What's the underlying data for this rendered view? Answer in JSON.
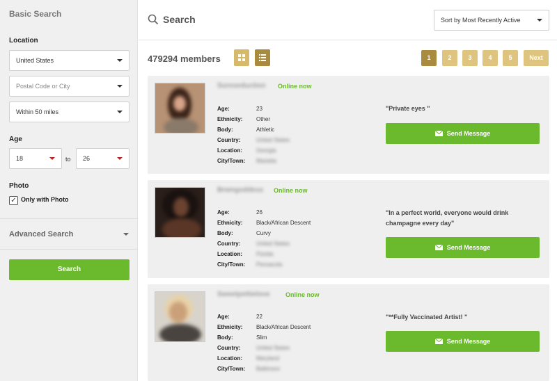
{
  "sidebar": {
    "title": "Basic Search",
    "location_label": "Location",
    "country": "United States",
    "postal_placeholder": "Postal Code or City",
    "distance": "Within 50 miles",
    "age_label": "Age",
    "age_min": "18",
    "age_to": "to",
    "age_max": "26",
    "photo_label": "Photo",
    "photo_checkbox_label": "Only with Photo",
    "photo_checked": "✓",
    "advanced_label": "Advanced Search",
    "search_button": "Search"
  },
  "header": {
    "title": "Search",
    "sort_value": "Sort by Most Recently Active"
  },
  "toolbar": {
    "members_count": "479294 members",
    "pages": [
      "1",
      "2",
      "3",
      "4",
      "5"
    ],
    "active_page": "1",
    "next_label": "Next"
  },
  "detail_labels": {
    "age": "Age:",
    "ethnicity": "Ethnicity:",
    "body": "Body:",
    "country": "Country:",
    "location": "Location:",
    "city": "City/Town:"
  },
  "profiles": [
    {
      "username": "Sureseduction",
      "status": "Online now",
      "age": "23",
      "ethnicity": "Other",
      "body": "Athletic",
      "country": "United States",
      "location": "Georgia",
      "city": "Marietta",
      "quote": "\"Private eyes \"",
      "message_button": "Send Message"
    },
    {
      "username": "Brwngoddess",
      "status": "Online now",
      "age": "26",
      "ethnicity": "Black/African Descent",
      "body": "Curvy",
      "country": "United States",
      "location": "Florida",
      "city": "Pensacola",
      "quote": "\"In a perfect world, everyone would drink champagne every day\"",
      "message_button": "Send Message"
    },
    {
      "username": "Sweetpettielove",
      "status": "Online now",
      "age": "22",
      "ethnicity": "Black/African Descent",
      "body": "Slim",
      "country": "United States",
      "location": "Maryland",
      "city": "Baltimore",
      "quote": "\"**Fully Vaccinated Artist! \"",
      "message_button": "Send Message"
    }
  ],
  "colors": {
    "accent_green": "#6bba2e",
    "gold": "#dfc480",
    "gold_dark": "#a88b3e"
  }
}
